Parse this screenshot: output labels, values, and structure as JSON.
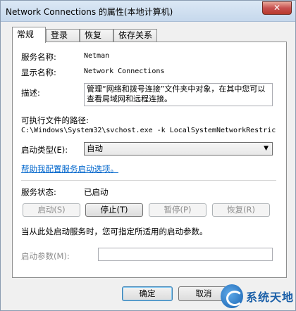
{
  "window": {
    "title": "Network Connections 的属性(本地计算机)",
    "close_glyph": "✕"
  },
  "tabs": [
    {
      "label": "常规",
      "active": true
    },
    {
      "label": "登录",
      "active": false
    },
    {
      "label": "恢复",
      "active": false
    },
    {
      "label": "依存关系",
      "active": false
    }
  ],
  "general": {
    "service_name_label": "服务名称:",
    "service_name_value": "Netman",
    "display_name_label": "显示名称:",
    "display_name_value": "Network Connections",
    "description_label": "描述:",
    "description_value": "管理“网络和拨号连接”文件夹中对象，在其中您可以查看局域网和远程连接。",
    "exe_path_label": "可执行文件的路径:",
    "exe_path_value": "C:\\Windows\\System32\\svchost.exe -k LocalSystemNetworkRestric",
    "startup_type_label": "启动类型(E):",
    "startup_type_value": "自动",
    "help_link": "帮助我配置服务启动选项。",
    "service_status_label": "服务状态:",
    "service_status_value": "已启动",
    "start_button": "启动(S)",
    "stop_button": "停止(T)",
    "pause_button": "暂停(P)",
    "resume_button": "恢复(R)",
    "start_params_hint": "当从此处启动服务时，您可指定所适用的启动参数。",
    "start_params_label": "启动参数(M):",
    "start_params_value": ""
  },
  "footer": {
    "ok_button": "确定",
    "cancel_button": "取消"
  },
  "watermark": {
    "text": "系统天地"
  }
}
